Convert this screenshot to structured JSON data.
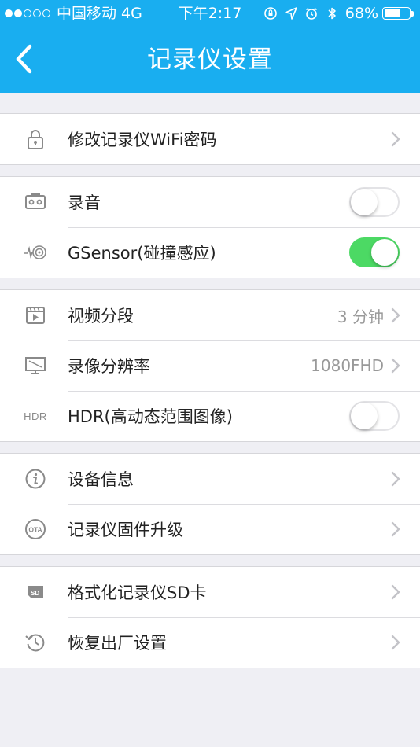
{
  "status_bar": {
    "carrier": "中国移动",
    "network": "4G",
    "time": "下午2:17",
    "battery_percent_text": "68%",
    "battery_level": 0.68,
    "signal_bars": 2
  },
  "nav": {
    "title": "记录仪设置"
  },
  "colors": {
    "header": "#19aef0",
    "toggle_on": "#4cd964",
    "background": "#efeff4"
  },
  "groups": [
    {
      "rows": [
        {
          "label": "修改记录仪WiFi密码",
          "icon": "lock-icon",
          "accessory": "chevron"
        }
      ]
    },
    {
      "rows": [
        {
          "label": "录音",
          "icon": "tape-icon",
          "accessory": "toggle",
          "on": false
        },
        {
          "label": "GSensor(碰撞感应)",
          "icon": "sensor-icon",
          "accessory": "toggle",
          "on": true
        }
      ]
    },
    {
      "rows": [
        {
          "label": "视频分段",
          "icon": "video-clip-icon",
          "accessory": "chevron",
          "value": "3 分钟"
        },
        {
          "label": "录像分辨率",
          "icon": "monitor-icon",
          "accessory": "chevron",
          "value": "1080FHD"
        },
        {
          "label": "HDR(高动态范围图像)",
          "icon": "hdr-icon",
          "icon_text": "HDR",
          "accessory": "toggle",
          "on": false
        }
      ]
    },
    {
      "rows": [
        {
          "label": "设备信息",
          "icon": "info-icon",
          "accessory": "chevron"
        },
        {
          "label": "记录仪固件升级",
          "icon": "ota-icon",
          "icon_text": "OTA",
          "accessory": "chevron"
        }
      ]
    },
    {
      "rows": [
        {
          "label": "格式化记录仪SD卡",
          "icon": "sd-card-icon",
          "accessory": "chevron"
        },
        {
          "label": "恢复出厂设置",
          "icon": "restore-icon",
          "accessory": "chevron"
        }
      ]
    }
  ]
}
